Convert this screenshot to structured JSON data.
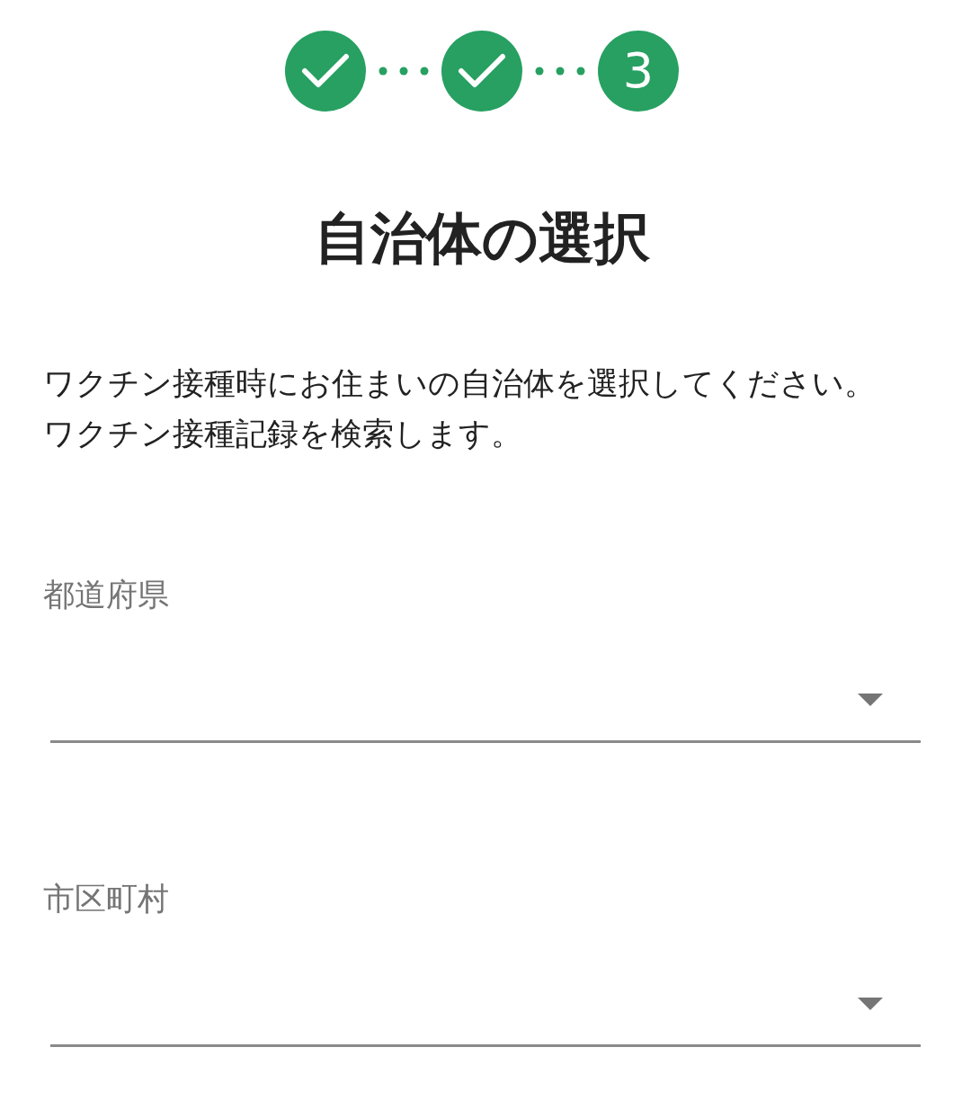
{
  "stepper": {
    "steps": [
      {
        "completed": true
      },
      {
        "completed": true
      },
      {
        "completed": false,
        "label": "3"
      }
    ]
  },
  "title": "自治体の選択",
  "description": [
    "ワクチン接種時にお住まいの自治体を選択してください。",
    "ワクチン接種記録を検索します。"
  ],
  "fields": [
    {
      "label": "都道府県"
    },
    {
      "label": "市区町村"
    }
  ]
}
